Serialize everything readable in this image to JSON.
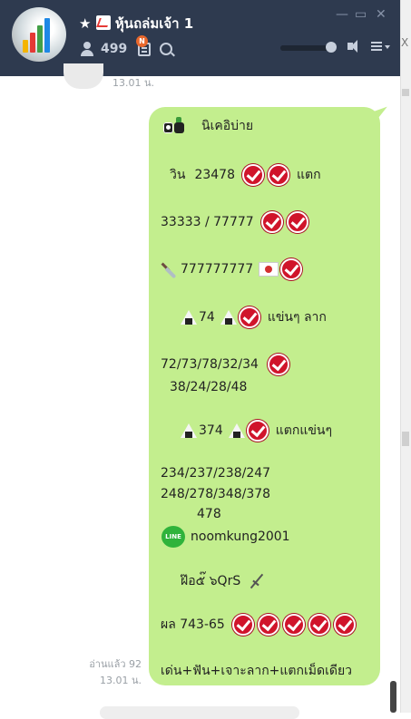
{
  "header": {
    "title": "★ 📈 หุ้นถล่มเจ้า 1",
    "title_star": "★",
    "title_text": "หุ้นถล่มเจ้า 1",
    "member_count": "499",
    "notes_badge": "N",
    "window_controls": {
      "minimize": "—",
      "maximize": "▭",
      "close": "✕"
    },
    "volume_level": 1.0
  },
  "edge": {
    "x_glyph": "X"
  },
  "previous_message": {
    "time": "13.01 น."
  },
  "message": {
    "read_label": "อ่านแล้ว 92",
    "time": "13.01 น.",
    "lines": {
      "heading": "นิเคอิบ่าย",
      "l1_prefix": "วิน",
      "l1_num": "23478",
      "l1_suffix": "แตก",
      "l2": "33333 / 77777",
      "l3": "777777777",
      "l4_num": "74",
      "l4_suffix": "แข่นๆ ลาก",
      "l5": "72/73/78/32/34",
      "l6": "38/24/28/48",
      "l7_num": "374",
      "l7_suffix": "แตกแข่นๆ",
      "l8": "234/237/238/247",
      "l9": "248/278/348/378",
      "l10": "478",
      "line_logo": "LINE",
      "line_id": "noomkung2001",
      "signature": "ฝ๊อ๕๊ ๖QrS",
      "result_prefix": "ผล 743-65",
      "footer": "เด่น+ฟัน+เจาะลาก+แตกเม็ดเดียว"
    }
  },
  "colors": {
    "header_bg": "#2e3a4f",
    "bubble_bg": "#c3ee8e",
    "check_red": "#d0142b"
  },
  "icons": [
    "person-icon",
    "note-icon",
    "search-icon",
    "speaker-icon",
    "menu-icon",
    "sushi-icon",
    "onigiri-icon",
    "knife-icon",
    "flag-icon",
    "line-logo-icon",
    "sword-icon",
    "check-icon"
  ]
}
